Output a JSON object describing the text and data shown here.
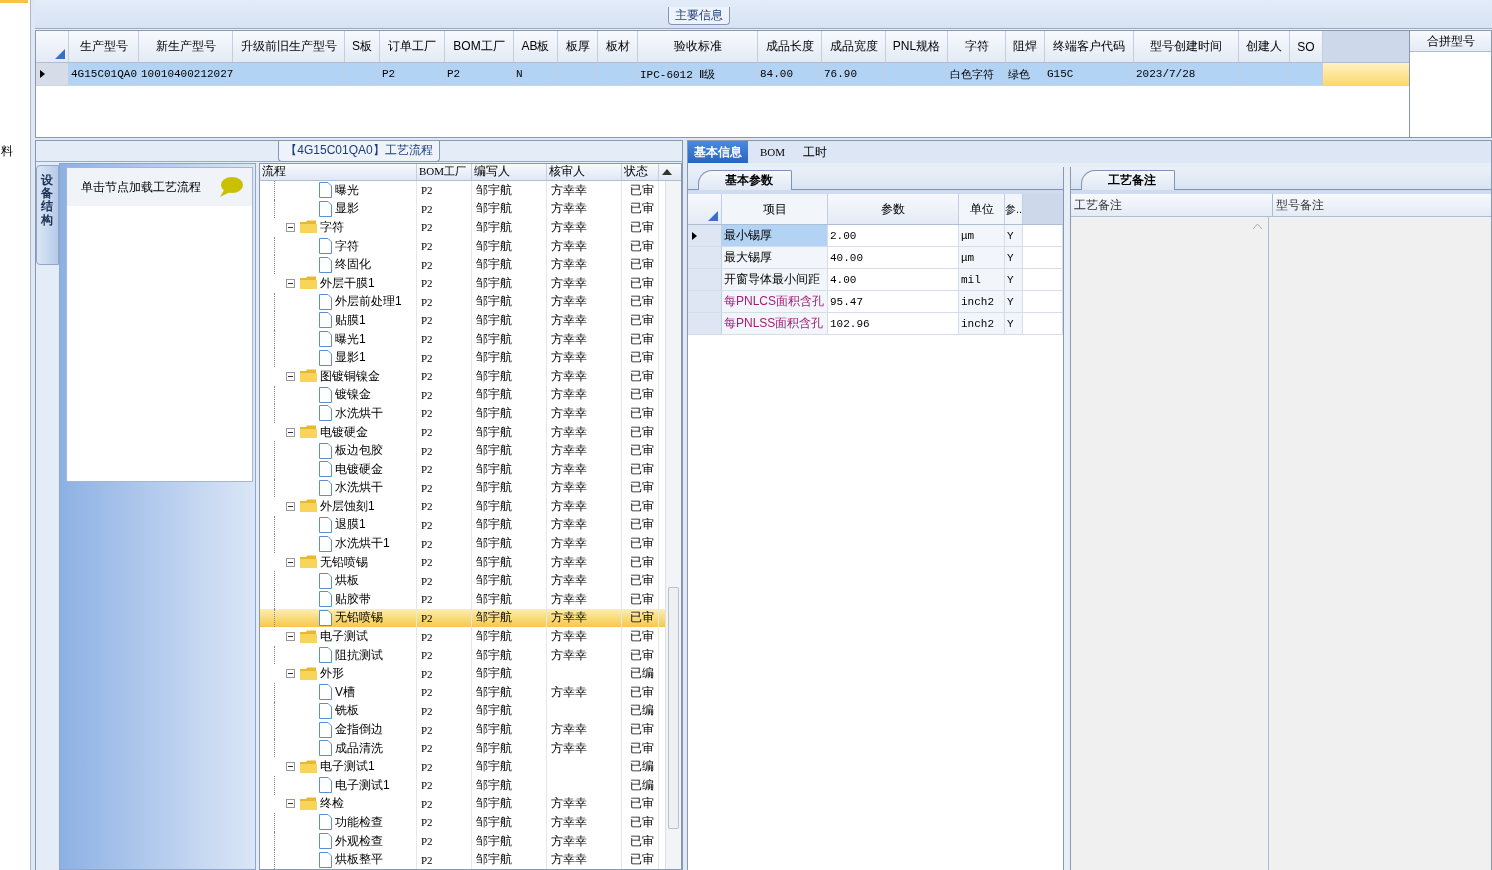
{
  "side_strip": {
    "label": "料"
  },
  "main_info": {
    "title": "主要信息",
    "row_selected": true,
    "columns": [
      {
        "label": "生产型号",
        "value": "4G15C01QA0"
      },
      {
        "label": "新生产型号",
        "value": "10010400212027"
      },
      {
        "label": "升级前旧生产型号"
      },
      {
        "label": "S板"
      },
      {
        "label": "订单工厂",
        "value": "P2"
      },
      {
        "label": "BOM工厂",
        "value": "P2"
      },
      {
        "label": "AB板",
        "value": "N"
      },
      {
        "label": "板厚"
      },
      {
        "label": "板材"
      },
      {
        "label": "验收标准",
        "value": "IPC-6012 Ⅱ级"
      },
      {
        "label": "成品长度",
        "value": "84.00"
      },
      {
        "label": "成品宽度",
        "value": "76.90"
      },
      {
        "label": "PNL规格"
      },
      {
        "label": "字符",
        "value": "白色字符"
      },
      {
        "label": "阻焊",
        "value": "绿色"
      },
      {
        "label": "终端客户代码",
        "value": "G15C"
      },
      {
        "label": "型号创建时间",
        "value": "2023/7/28"
      },
      {
        "label": "创建人"
      },
      {
        "label": "SO"
      }
    ],
    "merge_column": {
      "label": "合拼型号"
    }
  },
  "process": {
    "title": "【4G15C01QA0】工艺流程",
    "side_tab": "设备结构",
    "hint": "单击节点加载工艺流程",
    "columns": [
      "流程",
      "BOM工厂",
      "编写人",
      "核审人",
      "状态"
    ],
    "rows": [
      {
        "children": [
          {
            "label": "曝光",
            "bom": "P2",
            "writer": "邹宇航",
            "checker": "方幸幸",
            "status": "已审",
            "selected": false
          },
          {
            "label": "显影",
            "bom": "P2",
            "writer": "邹宇航",
            "checker": "方幸幸",
            "status": "已审",
            "selected": false
          }
        ]
      },
      {
        "label": "字符",
        "bom": "P2",
        "writer": "邹宇航",
        "checker": "方幸幸",
        "status": "已审",
        "expanded": true,
        "selected": false,
        "children": [
          {
            "label": "字符",
            "bom": "P2",
            "writer": "邹宇航",
            "checker": "方幸幸",
            "status": "已审",
            "selected": false
          },
          {
            "label": "终固化",
            "bom": "P2",
            "writer": "邹宇航",
            "checker": "方幸幸",
            "status": "已审",
            "selected": false
          }
        ]
      },
      {
        "label": "外层干膜1",
        "bom": "P2",
        "writer": "邹宇航",
        "checker": "方幸幸",
        "status": "已审",
        "expanded": true,
        "selected": false,
        "children": [
          {
            "label": "外层前处理1",
            "bom": "P2",
            "writer": "邹宇航",
            "checker": "方幸幸",
            "status": "已审",
            "selected": false
          },
          {
            "label": "贴膜1",
            "bom": "P2",
            "writer": "邹宇航",
            "checker": "方幸幸",
            "status": "已审",
            "selected": false
          },
          {
            "label": "曝光1",
            "bom": "P2",
            "writer": "邹宇航",
            "checker": "方幸幸",
            "status": "已审",
            "selected": false
          },
          {
            "label": "显影1",
            "bom": "P2",
            "writer": "邹宇航",
            "checker": "方幸幸",
            "status": "已审",
            "selected": false
          }
        ]
      },
      {
        "label": "图镀铜镍金",
        "bom": "P2",
        "writer": "邹宇航",
        "checker": "方幸幸",
        "status": "已审",
        "expanded": true,
        "selected": false,
        "children": [
          {
            "label": "镀镍金",
            "bom": "P2",
            "writer": "邹宇航",
            "checker": "方幸幸",
            "status": "已审",
            "selected": false
          },
          {
            "label": "水洗烘干",
            "bom": "P2",
            "writer": "邹宇航",
            "checker": "方幸幸",
            "status": "已审",
            "selected": false
          }
        ]
      },
      {
        "label": "电镀硬金",
        "bom": "P2",
        "writer": "邹宇航",
        "checker": "方幸幸",
        "status": "已审",
        "expanded": true,
        "selected": false,
        "children": [
          {
            "label": "板边包胶",
            "bom": "P2",
            "writer": "邹宇航",
            "checker": "方幸幸",
            "status": "已审",
            "selected": false
          },
          {
            "label": "电镀硬金",
            "bom": "P2",
            "writer": "邹宇航",
            "checker": "方幸幸",
            "status": "已审",
            "selected": false
          },
          {
            "label": "水洗烘干",
            "bom": "P2",
            "writer": "邹宇航",
            "checker": "方幸幸",
            "status": "已审",
            "selected": false
          }
        ]
      },
      {
        "label": "外层蚀刻1",
        "bom": "P2",
        "writer": "邹宇航",
        "checker": "方幸幸",
        "status": "已审",
        "expanded": true,
        "selected": false,
        "children": [
          {
            "label": "退膜1",
            "bom": "P2",
            "writer": "邹宇航",
            "checker": "方幸幸",
            "status": "已审",
            "selected": false
          },
          {
            "label": "水洗烘干1",
            "bom": "P2",
            "writer": "邹宇航",
            "checker": "方幸幸",
            "status": "已审",
            "selected": false
          }
        ]
      },
      {
        "label": "无铅喷锡",
        "bom": "P2",
        "writer": "邹宇航",
        "checker": "方幸幸",
        "status": "已审",
        "expanded": true,
        "selected": false,
        "children": [
          {
            "label": "烘板",
            "bom": "P2",
            "writer": "邹宇航",
            "checker": "方幸幸",
            "status": "已审",
            "selected": false
          },
          {
            "label": "贴胶带",
            "bom": "P2",
            "writer": "邹宇航",
            "checker": "方幸幸",
            "status": "已审",
            "selected": false
          },
          {
            "label": "无铅喷锡",
            "bom": "P2",
            "writer": "邹宇航",
            "checker": "方幸幸",
            "status": "已审",
            "selected": true
          }
        ]
      },
      {
        "label": "电子测试",
        "bom": "P2",
        "writer": "邹宇航",
        "checker": "方幸幸",
        "status": "已审",
        "expanded": true,
        "selected": false,
        "children": [
          {
            "label": "阻抗测试",
            "bom": "P2",
            "writer": "邹宇航",
            "checker": "方幸幸",
            "status": "已审",
            "selected": false
          }
        ]
      },
      {
        "label": "外形",
        "bom": "P2",
        "writer": "邹宇航",
        "status": "已编",
        "expanded": true,
        "selected": false,
        "children": [
          {
            "label": "V槽",
            "bom": "P2",
            "writer": "邹宇航",
            "checker": "方幸幸",
            "status": "已审",
            "selected": false
          },
          {
            "label": "铣板",
            "bom": "P2",
            "writer": "邹宇航",
            "status": "已编",
            "selected": false
          },
          {
            "label": "金指倒边",
            "bom": "P2",
            "writer": "邹宇航",
            "checker": "方幸幸",
            "status": "已审",
            "selected": false
          },
          {
            "label": "成品清洗",
            "bom": "P2",
            "writer": "邹宇航",
            "checker": "方幸幸",
            "status": "已审",
            "selected": false
          }
        ]
      },
      {
        "label": "电子测试1",
        "bom": "P2",
        "writer": "邹宇航",
        "status": "已编",
        "expanded": true,
        "selected": false,
        "children": [
          {
            "label": "电子测试1",
            "bom": "P2",
            "writer": "邹宇航",
            "status": "已编",
            "selected": false
          }
        ]
      },
      {
        "label": "终检",
        "bom": "P2",
        "writer": "邹宇航",
        "checker": "方幸幸",
        "status": "已审",
        "expanded": true,
        "selected": false,
        "children": [
          {
            "label": "功能检查",
            "bom": "P2",
            "writer": "邹宇航",
            "checker": "方幸幸",
            "status": "已审",
            "selected": false
          },
          {
            "label": "外观检查",
            "bom": "P2",
            "writer": "邹宇航",
            "checker": "方幸幸",
            "status": "已审",
            "selected": false
          },
          {
            "label": "烘板整平",
            "bom": "P2",
            "writer": "邹宇航",
            "checker": "方幸幸",
            "status": "已审",
            "selected": false
          }
        ]
      }
    ]
  },
  "tabs": [
    {
      "label": "基本信息",
      "selected": true
    },
    {
      "label": "BOM",
      "selected": false
    },
    {
      "label": "工时",
      "selected": false
    }
  ],
  "params": {
    "tab": "基本参数",
    "columns": [
      "项目",
      "参数",
      "单位",
      "参.."
    ],
    "rows": [
      {
        "item": "最小锡厚",
        "value": "2.00",
        "unit": "μm",
        "flag": "Y",
        "selected": true
      },
      {
        "item": "最大锡厚",
        "value": "40.00",
        "unit": "μm",
        "flag": "Y",
        "selected": false
      },
      {
        "item": "开窗导体最小间距",
        "value": "4.00",
        "unit": "mil",
        "flag": "Y",
        "selected": false
      },
      {
        "item": "每PNLCS面积含孔",
        "value": "95.47",
        "unit": "inch2",
        "flag": "Y",
        "selected": false,
        "color": "#a0207a"
      },
      {
        "item": "每PNLSS面积含孔",
        "value": "102.96",
        "unit": "inch2",
        "flag": "Y",
        "selected": false,
        "color": "#a0207a"
      }
    ]
  },
  "notes": {
    "tab": "工艺备注",
    "columns": [
      "工艺备注",
      "型号备注"
    ]
  }
}
